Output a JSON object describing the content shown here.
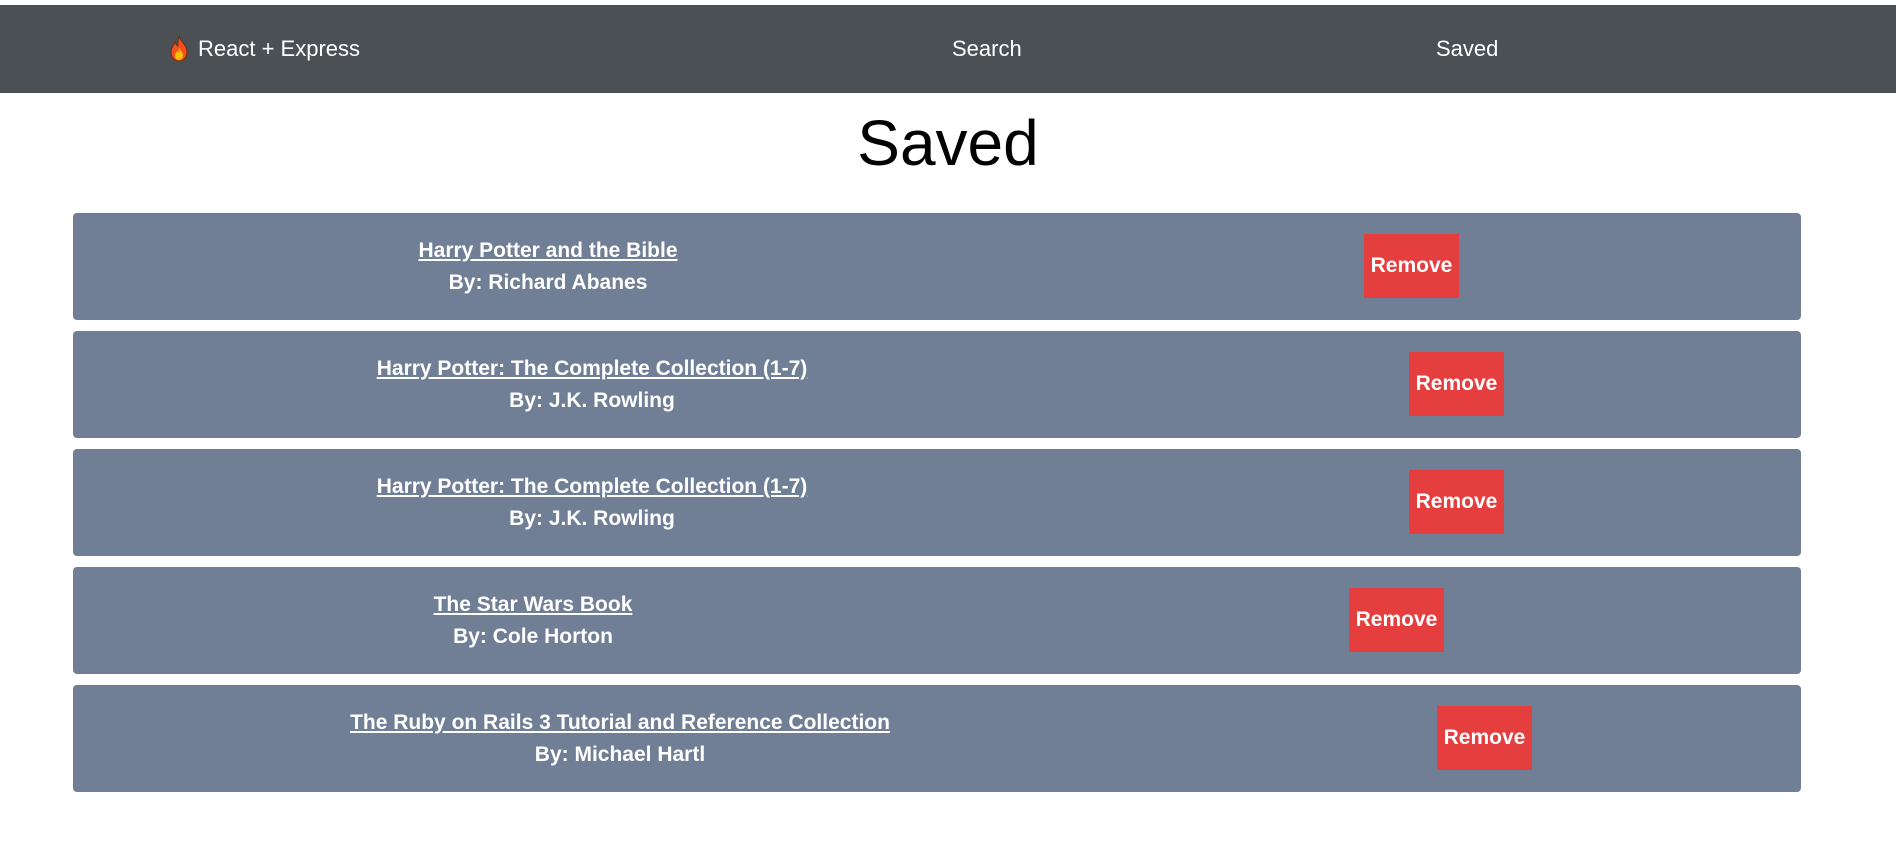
{
  "nav": {
    "brand": "React + Express",
    "links": [
      "Search",
      "Saved"
    ]
  },
  "page": {
    "title": "Saved"
  },
  "books": [
    {
      "title": "Harry Potter and the Bible",
      "author": "By: Richard Abanes",
      "action": "Remove"
    },
    {
      "title": "Harry Potter: The Complete Collection (1-7)",
      "author": "By: J.K. Rowling",
      "action": "Remove"
    },
    {
      "title": "Harry Potter: The Complete Collection (1-7)",
      "author": "By: J.K. Rowling",
      "action": "Remove"
    },
    {
      "title": "The Star Wars Book",
      "author": "By: Cole Horton",
      "action": "Remove"
    },
    {
      "title": "The Ruby on Rails 3 Tutorial and Reference Collection",
      "author": "By: Michael Hartl",
      "action": "Remove"
    }
  ],
  "colors": {
    "navbar": "#4b5055",
    "card": "#717f96",
    "remove_button": "#e53e3e"
  }
}
